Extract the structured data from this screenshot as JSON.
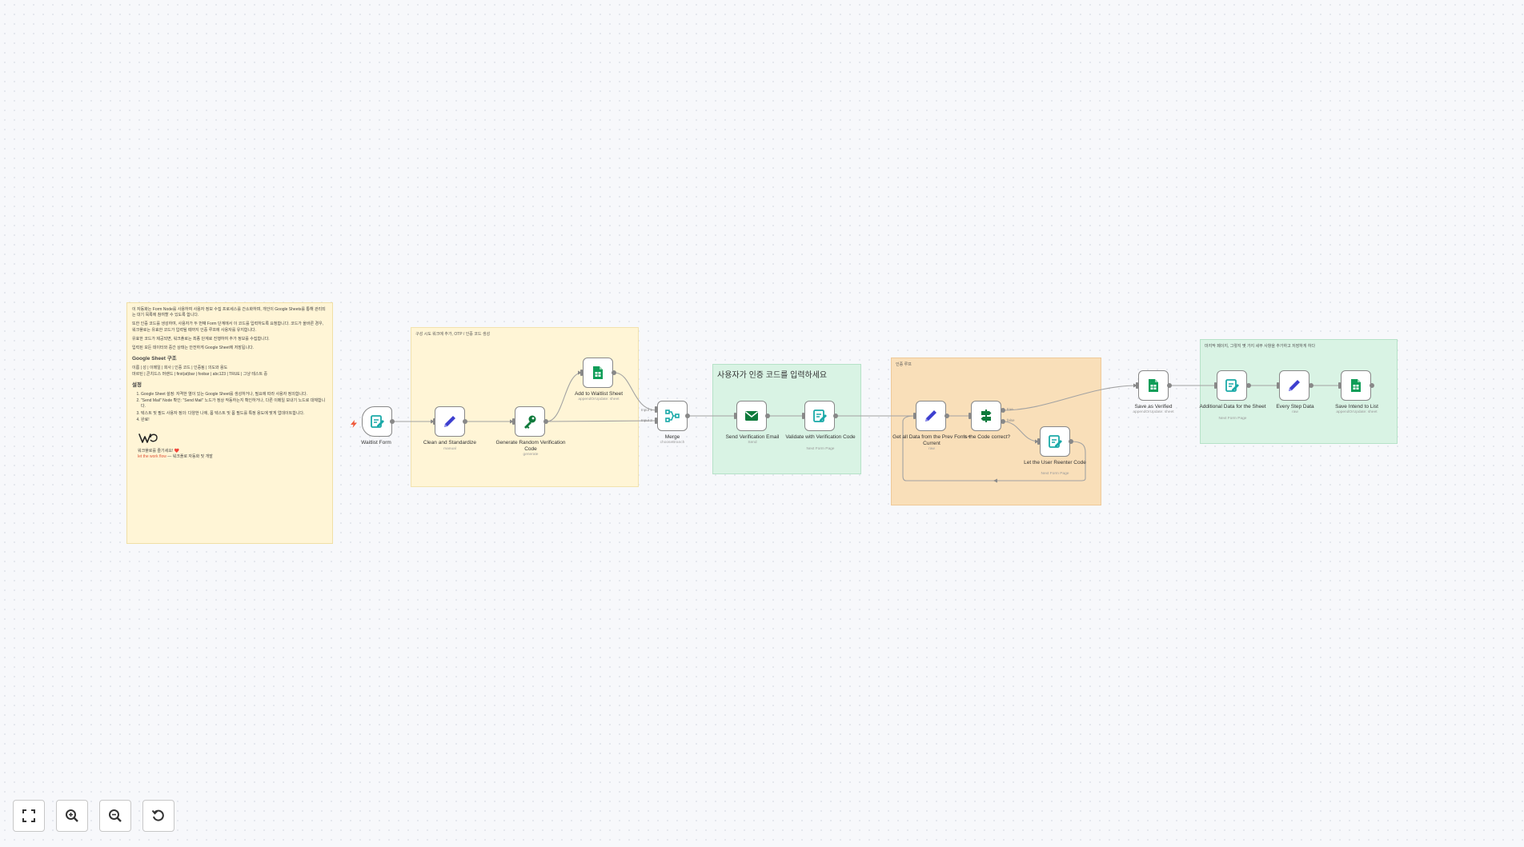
{
  "intro_note": {
    "paragraphs": [
      "이 자동화는 Form Node를 사용하여 사용자 정보 수집 프로세스를 간소화하며, 개인이 Google Sheets를 통해 관리되는 대기 목록에 참여할 수 있도록 합니다.",
      "또한 인증 코드를 생성하여, 사용자가 두 번째 Form 단계에서 이 코드를 입력하도록 요청합니다. 코드가 올바른 경우, 워크플로는 유효한 코드가 입력될 때까지 인증 루프에 사용자를 유지합니다.",
      "유효한 코드가 제공되면, 워크플로는 최종 단계로 진행하여 추가 정보를 수집합니다.",
      "입력된 모든 데이터와 중간 상태는 안전하게 Google Sheet에 저장됩니다."
    ],
    "sheet_heading": "Google Sheet 구조",
    "sheet_lines": [
      "이름 | 성 | 이메일 | 회사 | 인증 코드 | 인증됨 | 의도와 용도",
      "마르틴 | 콘치드스 머랜드 | first(at)bar | foobar | abc123 | TRUE | 그냥 테스트 중"
    ],
    "setup_heading": "설정",
    "setup_steps": [
      "Google Sheet 설정: 자격한 열이 있는 Google Sheet를 생성하거나, 필요에 따라 사용자 정의합니다.",
      "\"Send Mail\" Node 확인: \"Send Mail\" 노드가 정상 작동하는지 확인하거나, 다른 이메일 보내기 노드로 대체합니다.",
      "텍스트 및 필드 사용자 정의: 다양한 나에, 폼 텍스트 및 폼 필드를 특정 용도에 맞게 업데이트합니다.",
      "완료!"
    ],
    "footer_line": "워크플로를 즐기세요! ❤️",
    "footer_link": "let the work flow",
    "footer_tail": " — 워크플로 자동화 및 개발"
  },
  "groups": {
    "g1": "구성 시도 워크에 추가, OTP / 인증 코드 생성",
    "g2": "사용자가 인증 코드를 입력하세요",
    "g3": "인증 루프",
    "g4": "마지막 페이지, 그렇지 몇 가지 세부 사항을 추가하고 저장하게 하다"
  },
  "nodes": {
    "waitlist_form": {
      "name": "Waitlist Form",
      "icon": "form-icon",
      "color": "#1aa9a8"
    },
    "clean": {
      "name": "Clean and Standardize",
      "sub": "manual",
      "icon": "pencil-icon",
      "color": "#3d3fcf"
    },
    "generate": {
      "name": "Generate Random Verification Code",
      "sub": "generate",
      "icon": "key-icon",
      "color": "#0f7a3c"
    },
    "add_sheet": {
      "name": "Add to Waitlist Sheet",
      "sub": "appendOrUpdate: sheet",
      "icon": "sheets-icon",
      "color": "#0f9d58"
    },
    "merge": {
      "name": "Merge",
      "sub": "chooseBranch",
      "icon": "merge-icon",
      "color": "#1aa9a8"
    },
    "send_email": {
      "name": "Send Verification Email",
      "sub": "Send",
      "icon": "envelope-icon",
      "color": "#0f7a3c"
    },
    "validate": {
      "name": "Validate with Verification Code",
      "sub": "Next Form Page",
      "icon": "form-icon",
      "color": "#1aa9a8"
    },
    "get_all": {
      "name": "Get all Data from the Prev Form + Current",
      "sub": "raw",
      "icon": "pencil-icon",
      "color": "#3d3fcf"
    },
    "is_correct": {
      "name": "is the Code correct?",
      "icon": "if-icon",
      "color": "#0f7a3c"
    },
    "reenter": {
      "name": "Let the User Reenter Code",
      "sub": "Next Form Page",
      "icon": "form-icon",
      "color": "#1aa9a8"
    },
    "save_verified": {
      "name": "Save as Verified",
      "sub": "appendOrUpdate: sheet",
      "icon": "sheets-icon",
      "color": "#0f9d58"
    },
    "additional": {
      "name": "Additional Data for the Sheet",
      "sub": "Next Form Page",
      "icon": "form-icon",
      "color": "#1aa9a8"
    },
    "every_step": {
      "name": "Every Step Data",
      "sub": "raw",
      "icon": "pencil-icon",
      "color": "#3d3fcf"
    },
    "save_intend": {
      "name": "Save Intend to List",
      "sub": "appendOrUpdate: sheet",
      "icon": "sheets-icon",
      "color": "#0f9d58"
    }
  },
  "port_labels": {
    "input1": "Input 1",
    "input2": "Input 2",
    "true": "true",
    "false": "false"
  },
  "controls": {
    "fit": "fit-view-icon",
    "zoom_in": "zoom-in-icon",
    "zoom_out": "zoom-out-icon",
    "reset": "reset-zoom-icon"
  }
}
